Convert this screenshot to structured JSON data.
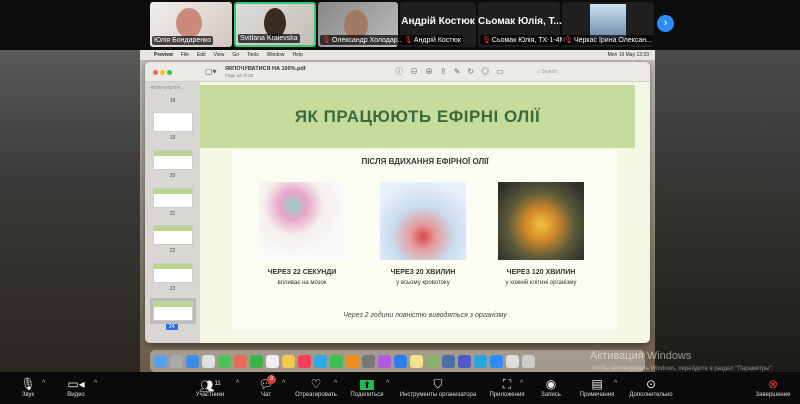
{
  "participants": [
    {
      "name": "Юлія Бондаренко",
      "muted": false
    },
    {
      "name": "Svitlana Kraievska",
      "muted": false,
      "active": true
    },
    {
      "name": "Олександр Холодар...",
      "muted": true
    },
    {
      "name": "Андрій Костюк",
      "display": "Андрій Костюк",
      "muted": true
    },
    {
      "name": "Сьомак Юлія, ТХ-1-4М",
      "display": "Сьомак  Юлія, Т...",
      "muted": true
    },
    {
      "name": "Черкас Ірина Олексан...",
      "muted": true
    }
  ],
  "mac_menu": {
    "app": "Preview",
    "items": [
      "File",
      "Edit",
      "View",
      "Go",
      "Tools",
      "Window",
      "Help"
    ],
    "clock": "Mon 19 May 12:33"
  },
  "preview": {
    "filename": "ЯКПОЧУВАТИСЯ НА 100%.pdf",
    "page_info": "Page 24 of 28",
    "search_placeholder": "Search",
    "sidebar_title": "ЯКПОЧУВАТИ...",
    "pages": [
      "18",
      "19",
      "20",
      "21",
      "22",
      "23",
      "24"
    ],
    "selected_page": "24"
  },
  "slide": {
    "title": "ЯК ПРАЦЮЮТЬ ЕФІРНІ ОЛІЇ",
    "subtitle": "ПІСЛЯ ВДИХАННЯ ЕФІРНОЇ ОЛІЇ",
    "columns": [
      {
        "caption": "ЧЕРЕЗ 22 СЕКУНДИ",
        "sub": "впливає на мозок"
      },
      {
        "caption": "ЧЕРЕЗ 20 ХВИЛИН",
        "sub": "у всьому кровотоку"
      },
      {
        "caption": "ЧЕРЕЗ 120 ХВИЛИН",
        "sub": "у кожній клітині організму"
      }
    ],
    "footer": "Через 2 години повністю виводяться з організму"
  },
  "windows_watermark": {
    "title": "Активация Windows",
    "text": "Чтобы активировать Windows, перейдите в раздел \"Параметры\"."
  },
  "toolbar": {
    "audio": "Звук",
    "video": "Видео",
    "participants": "Участники",
    "participants_count": "11",
    "chat": "Чат",
    "chat_badge": "3",
    "react": "Отреагировать",
    "share": "Поделиться",
    "host_tools": "Инструменты организатора",
    "apps": "Приложения",
    "record": "Запись",
    "notes": "Примечания",
    "more": "Дополнительно",
    "end": "Завершение"
  },
  "colors": {
    "slide_header": "#c5dc9c",
    "title_text": "#3d6b3b",
    "zoom_blue": "#2d8cff",
    "share_green": "#1db954",
    "end_red": "#e0393e"
  }
}
